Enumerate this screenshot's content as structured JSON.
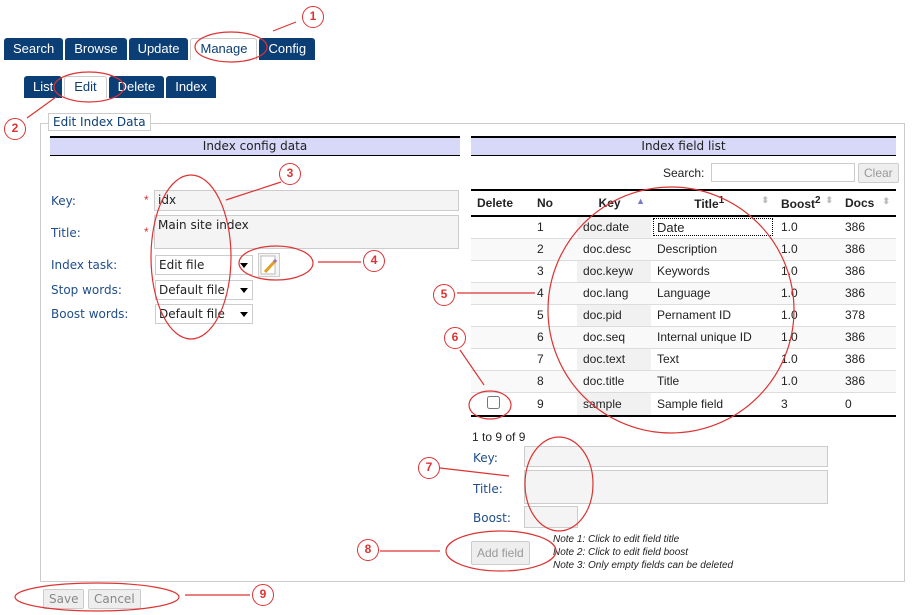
{
  "main_tabs": [
    "Search",
    "Browse",
    "Update",
    "Manage",
    "Config"
  ],
  "main_active": "Manage",
  "sub_tabs": [
    "List",
    "Edit",
    "Delete",
    "Index"
  ],
  "sub_active": "Edit",
  "fieldset_legend": "Edit Index Data",
  "config": {
    "header": "Index config data",
    "key_label": "Key:",
    "key_value": "idx",
    "title_label": "Title:",
    "title_value": "Main site index",
    "task_label": "Index task:",
    "task_value": "Edit file",
    "stop_label": "Stop words:",
    "stop_value": "Default file",
    "boost_label": "Boost words:",
    "boost_value": "Default file",
    "required_mark": "*"
  },
  "fields": {
    "header": "Index field list",
    "search_label": "Search:",
    "search_value": "",
    "clear_label": "Clear",
    "columns": [
      "Delete",
      "No",
      "Key",
      "Title",
      "Boost",
      "Docs"
    ],
    "title_sup": "1",
    "boost_sup": "2",
    "rows": [
      {
        "no": "1",
        "key": "doc.date",
        "title": "Date",
        "boost": "1.0",
        "docs": "386"
      },
      {
        "no": "2",
        "key": "doc.desc",
        "title": "Description",
        "boost": "1.0",
        "docs": "386"
      },
      {
        "no": "3",
        "key": "doc.keyw",
        "title": "Keywords",
        "boost": "1.0",
        "docs": "386"
      },
      {
        "no": "4",
        "key": "doc.lang",
        "title": "Language",
        "boost": "1.0",
        "docs": "386"
      },
      {
        "no": "5",
        "key": "doc.pid",
        "title": "Pernament ID",
        "boost": "1.0",
        "docs": "378"
      },
      {
        "no": "6",
        "key": "doc.seq",
        "title": "Internal unique ID",
        "boost": "1.0",
        "docs": "386"
      },
      {
        "no": "7",
        "key": "doc.text",
        "title": "Text",
        "boost": "1.0",
        "docs": "386"
      },
      {
        "no": "8",
        "key": "doc.title",
        "title": "Title",
        "boost": "1.0",
        "docs": "386"
      },
      {
        "no": "9",
        "key": "sample",
        "title": "Sample field",
        "boost": "3",
        "docs": "0",
        "deletable": true
      }
    ],
    "paging": "1 to 9 of 9",
    "new_key_label": "Key:",
    "new_title_label": "Title:",
    "new_boost_label": "Boost:",
    "add_label": "Add field",
    "notes": [
      "Note 1: Click to edit field title",
      "Note 2: Click to edit field boost",
      "Note 3: Only empty fields can be deleted"
    ]
  },
  "footer": {
    "save_label": "Save",
    "cancel_label": "Cancel"
  },
  "annotations": [
    "1",
    "2",
    "3",
    "4",
    "5",
    "6",
    "7",
    "8",
    "9"
  ]
}
